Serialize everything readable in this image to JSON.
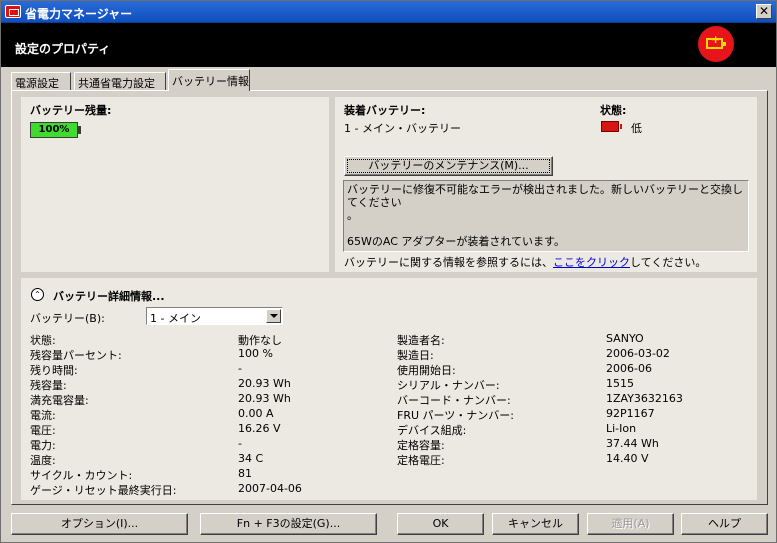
{
  "window": {
    "title": "省電力マネージャー",
    "close_glyph": "✕"
  },
  "header": {
    "title": "設定のプロパティ",
    "logo_icon": "battery-plus-icon"
  },
  "tabs": [
    {
      "label": "電源設定",
      "active": false
    },
    {
      "label": "共通省電力設定",
      "active": false
    },
    {
      "label": "バッテリー情報",
      "active": true
    }
  ],
  "battery_level": {
    "label": "バッテリー残量:",
    "value": "100%",
    "fill": 1.0
  },
  "installed": {
    "label": "装着バッテリー:",
    "value": "1 - メイン・バッテリー"
  },
  "status": {
    "label": "状態:",
    "value": "低"
  },
  "maintenance_button": "バッテリーのメンテナンス(M)...",
  "message": {
    "line1": "バッテリーに修復不可能なエラーが検出されました。新しいバッテリーと交換してください",
    "line2": "。",
    "line3": "65WのAC アダプターが装着されています。"
  },
  "info": {
    "prefix": "バッテリーに関する情報を参照するには、",
    "link": "ここをクリック",
    "suffix": "してください。"
  },
  "details": {
    "title": "バッテリー詳細情報...",
    "battery_label": "バッテリー(B):",
    "battery_selected": "1 - メイン",
    "left": [
      {
        "label": "状態:",
        "value": "動作なし"
      },
      {
        "label": "残容量パーセント:",
        "value": "100 %"
      },
      {
        "label": "残り時間:",
        "value": "-"
      },
      {
        "label": "残容量:",
        "value": "20.93 Wh"
      },
      {
        "label": "満充電容量:",
        "value": "20.93 Wh"
      },
      {
        "label": "電流:",
        "value": "0.00 A"
      },
      {
        "label": "電圧:",
        "value": "16.26 V"
      },
      {
        "label": "電力:",
        "value": "-"
      },
      {
        "label": "温度:",
        "value": "34 C"
      },
      {
        "label": "サイクル・カウント:",
        "value": "81"
      },
      {
        "label": "ゲージ・リセット最終実行日:",
        "value": "2007-04-06"
      }
    ],
    "right": [
      {
        "label": "製造者名:",
        "value": "SANYO"
      },
      {
        "label": "製造日:",
        "value": "2006-03-02"
      },
      {
        "label": "使用開始日:",
        "value": "2006-06"
      },
      {
        "label": "シリアル・ナンバー:",
        "value": "1515"
      },
      {
        "label": "バーコード・ナンバー:",
        "value": "1ZAY3632163"
      },
      {
        "label": "FRU パーツ・ナンバー:",
        "value": "92P1167"
      },
      {
        "label": "デバイス組成:",
        "value": "Li-Ion"
      },
      {
        "label": "定格容量:",
        "value": "37.44 Wh"
      },
      {
        "label": "定格電圧:",
        "value": "14.40 V"
      }
    ]
  },
  "buttons": {
    "options": "オプション(I)...",
    "fn_f3": "Fn + F3の設定(G)...",
    "ok": "OK",
    "cancel": "キャンセル",
    "apply": "適用(A)",
    "help": "ヘルプ"
  },
  "colors": {
    "titlebar": "#0f4fbe",
    "gauge_fill": "#3fdc2f",
    "status_low": "#d81515",
    "logo": "#e8141b"
  }
}
